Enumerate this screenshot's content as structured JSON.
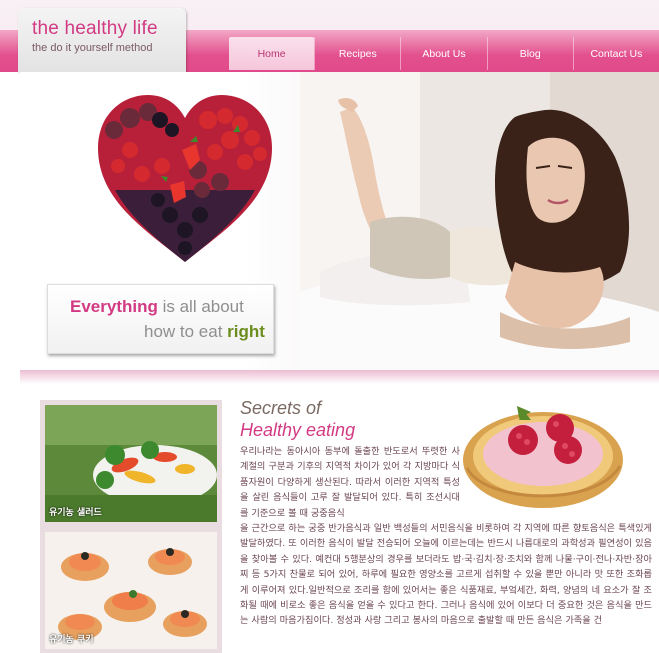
{
  "logo": {
    "title": "the healthy life",
    "subtitle": "the do it yourself method"
  },
  "nav": {
    "items": [
      {
        "label": "Home",
        "active": true
      },
      {
        "label": "Recipes",
        "active": false
      },
      {
        "label": "About Us",
        "active": false
      },
      {
        "label": "Blog",
        "active": false
      },
      {
        "label": "Contact Us",
        "active": false
      }
    ]
  },
  "hero": {
    "line1_em": "Everything",
    "line1_rest": " is all about",
    "line2_rest": "how to eat ",
    "line2_em": "right"
  },
  "sidebar": {
    "thumbs": [
      {
        "caption": "유기농 샐러드",
        "icon": "salad-photo"
      },
      {
        "caption": "유기농 쿠키",
        "icon": "canape-photo"
      }
    ]
  },
  "article": {
    "title_line1": "Secrets of",
    "title_line2": "Healthy eating",
    "para_top": "우리나라는 동아시아 동부에 돌출한 반도로서 뚜렷한 사계절의 구분과 기후의 지역적 차이가 있어 각 지방마다 식품자원이 다양하게 생산된다. 따라서 이러한 지역적 특성을 살린 음식들이 고루 잘 발달되어 있다. 특히 조선시대를 기준으로 볼 때 궁중음식",
    "para_bottom": "을 근간으로 하는 궁중 반가음식과 일반 백성들의 서민음식을 비롯하여 각 지역에 따른 향토음식은 특색있게 발달하였다. 또 이러한 음식이 발달 전승되어 오늘에 이르는데는 반드시 나름대로의 과학성과 필연성이 있음을 찾아볼 수 있다. 예컨대 5행분상의 경우를 보더라도 밥·국·김치·장·조치와 함께 나물·구이·전나·자반·장아찌 등 5가지 찬물로 되어 있어, 하루에 필요한 영양소를 고르게 섭취할 수 있을 뿐만 아니라 맛 또한 조화롭게 이루어져 있다.일반적으로 조리를 함에 있어서는 좋은 식품재료, 부엌세간, 화력, 양념의 네 요소가 잘 조화될 때에 비로소 좋은 음식을 얻을 수 있다고 한다. 그러나 음식에 있어 이보다 더 중요한 것은 음식을 만드는 사람의 마음가짐이다. 정성과 사랑 그리고 봉사의 마음으로 출발할 때 만든 음식은 가족을 건"
  },
  "colors": {
    "brand_pink": "#d23a83",
    "band_pink": "#e3508e",
    "green": "#6b8c1e"
  }
}
